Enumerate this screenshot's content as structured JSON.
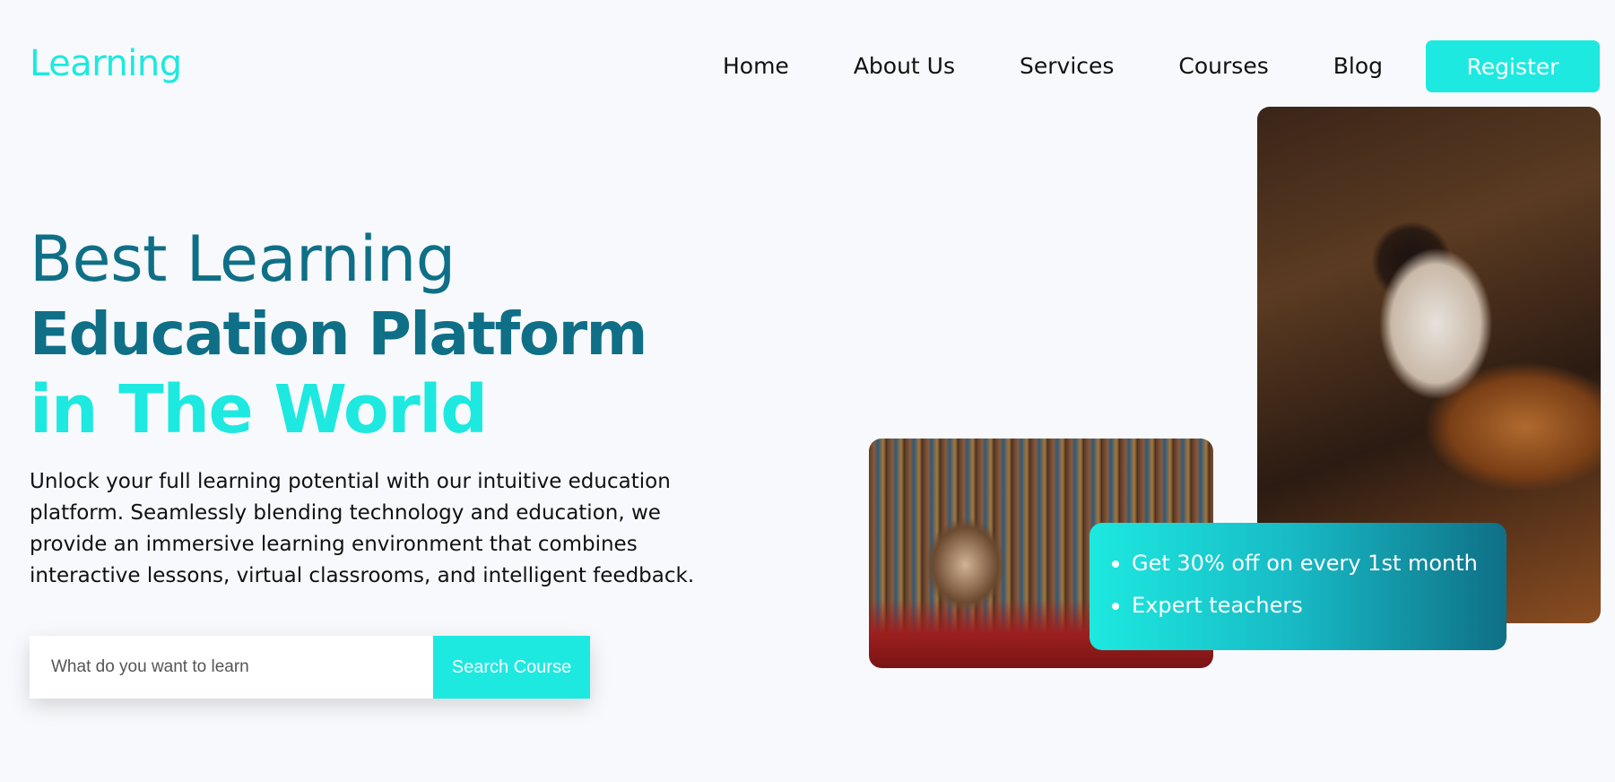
{
  "brand": {
    "logo_text": "Learning",
    "accent_color": "#1de9e0",
    "dark_color": "#0f6f86"
  },
  "nav": {
    "items": [
      {
        "label": "Home"
      },
      {
        "label": "About Us"
      },
      {
        "label": "Services"
      },
      {
        "label": "Courses"
      },
      {
        "label": "Blog"
      }
    ],
    "register_label": "Register"
  },
  "hero": {
    "title_line1": "Best Learning",
    "title_line2": "Education Platform",
    "title_line3": "in The World",
    "description": "Unlock your full learning potential with our intuitive education platform. Seamlessly blending technology and education, we provide an immersive learning environment that combines interactive lessons, virtual classrooms, and intelligent feedback."
  },
  "search": {
    "placeholder": "What do you want to learn",
    "button_label": "Search Course"
  },
  "promo": {
    "items": [
      {
        "text": "Get 30% off on every 1st month"
      },
      {
        "text": "Expert teachers"
      }
    ]
  }
}
